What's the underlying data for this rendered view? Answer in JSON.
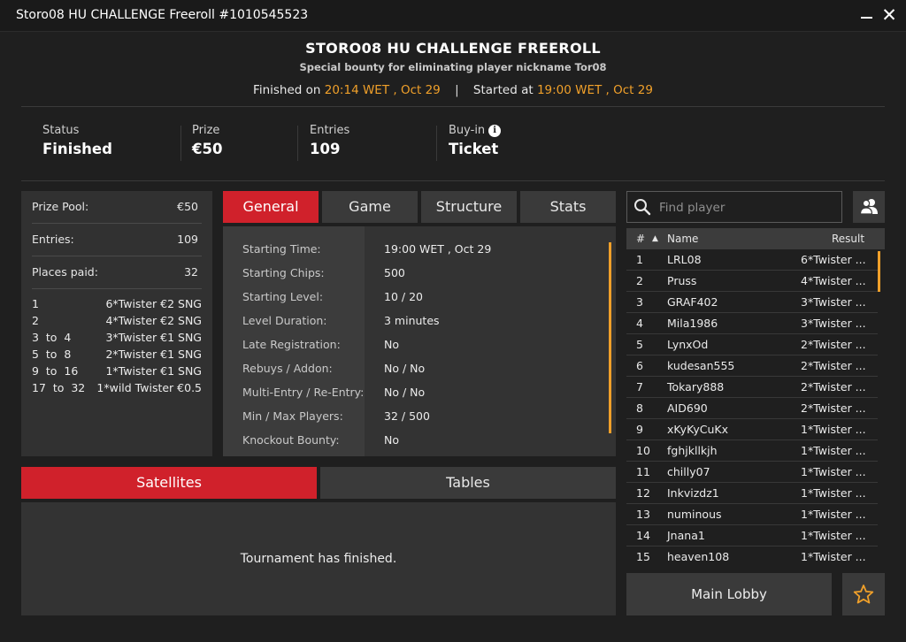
{
  "window": {
    "title": "Storo08 HU CHALLENGE Freeroll #1010545523"
  },
  "header": {
    "title": "STORO08 HU CHALLENGE FREEROLL",
    "subtitle": "Special bounty for eliminating player nickname Tor08",
    "finished_label": "Finished on",
    "finished_time": "20:14 WET , Oct 29",
    "separator": "|",
    "started_label": "Started at",
    "started_time": "19:00 WET , Oct 29"
  },
  "summary": {
    "status": {
      "label": "Status",
      "value": "Finished"
    },
    "prize": {
      "label": "Prize",
      "value": "€50"
    },
    "entries": {
      "label": "Entries",
      "value": "109"
    },
    "buyin": {
      "label": "Buy-in",
      "value": "Ticket",
      "icon": "info-icon"
    }
  },
  "prize_panel": {
    "rows": [
      {
        "label": "Prize Pool:",
        "value": "€50"
      },
      {
        "label": "Entries:",
        "value": "109"
      },
      {
        "label": "Places paid:",
        "value": "32"
      }
    ],
    "payouts": [
      {
        "place": "1",
        "prize": "6*Twister €2 SNG"
      },
      {
        "place": "2",
        "prize": "4*Twister €2 SNG"
      },
      {
        "place": "3  to  4",
        "prize": "3*Twister €1 SNG"
      },
      {
        "place": "5  to  8",
        "prize": "2*Twister €1 SNG"
      },
      {
        "place": "9  to  16",
        "prize": "1*Twister €1 SNG"
      },
      {
        "place": "17  to  32",
        "prize": "1*wild Twister €0.5"
      }
    ]
  },
  "tabs": [
    {
      "label": "General",
      "active": true
    },
    {
      "label": "Game",
      "active": false
    },
    {
      "label": "Structure",
      "active": false
    },
    {
      "label": "Stats",
      "active": false
    }
  ],
  "general": [
    {
      "key": "Starting Time:",
      "value": "19:00 WET , Oct 29"
    },
    {
      "key": "Starting Chips:",
      "value": "500"
    },
    {
      "key": "Starting Level:",
      "value": "10 / 20"
    },
    {
      "key": "Level Duration:",
      "value": "3 minutes"
    },
    {
      "key": "Late Registration:",
      "value": "No"
    },
    {
      "key": "Rebuys / Addon:",
      "value": "No / No"
    },
    {
      "key": "Multi-Entry / Re-Entry:",
      "value": "No / No"
    },
    {
      "key": "Min / Max Players:",
      "value": "32 / 500"
    },
    {
      "key": "Knockout Bounty:",
      "value": "No"
    }
  ],
  "bottom_tabs": [
    {
      "label": "Satellites",
      "active": true
    },
    {
      "label": "Tables",
      "active": false
    }
  ],
  "bottom_message": "Tournament has finished.",
  "search": {
    "placeholder": "Find player",
    "icon": "search-icon"
  },
  "players_button": {
    "icon": "players-icon"
  },
  "player_list": {
    "headers": {
      "num": "#",
      "sort": "▲",
      "name": "Name",
      "result": "Result"
    },
    "rows": [
      {
        "num": "1",
        "name": "LRL08",
        "result": "6*Twister ..."
      },
      {
        "num": "2",
        "name": "Pruss",
        "result": "4*Twister ..."
      },
      {
        "num": "3",
        "name": "GRAF402",
        "result": "3*Twister ..."
      },
      {
        "num": "4",
        "name": "Mila1986",
        "result": "3*Twister ..."
      },
      {
        "num": "5",
        "name": "LynxOd",
        "result": "2*Twister ..."
      },
      {
        "num": "6",
        "name": "kudesan555",
        "result": "2*Twister ..."
      },
      {
        "num": "7",
        "name": "Tokary888",
        "result": "2*Twister ..."
      },
      {
        "num": "8",
        "name": "AID690",
        "result": "2*Twister ..."
      },
      {
        "num": "9",
        "name": "xKyKyCuKx",
        "result": "1*Twister ..."
      },
      {
        "num": "10",
        "name": "fghjkllkjh",
        "result": "1*Twister ..."
      },
      {
        "num": "11",
        "name": "chilly07",
        "result": "1*Twister ..."
      },
      {
        "num": "12",
        "name": "Inkvizdz1",
        "result": "1*Twister ..."
      },
      {
        "num": "13",
        "name": "numinous",
        "result": "1*Twister ..."
      },
      {
        "num": "14",
        "name": "Jnana1",
        "result": "1*Twister ..."
      },
      {
        "num": "15",
        "name": "heaven108",
        "result": "1*Twister ..."
      }
    ]
  },
  "footer": {
    "main_lobby": "Main Lobby",
    "favorite_icon": "star-icon"
  },
  "colors": {
    "accent_red": "#d0212b",
    "accent_orange": "#f0a02a",
    "background": "#1f1f1f",
    "panel": "#333333"
  }
}
